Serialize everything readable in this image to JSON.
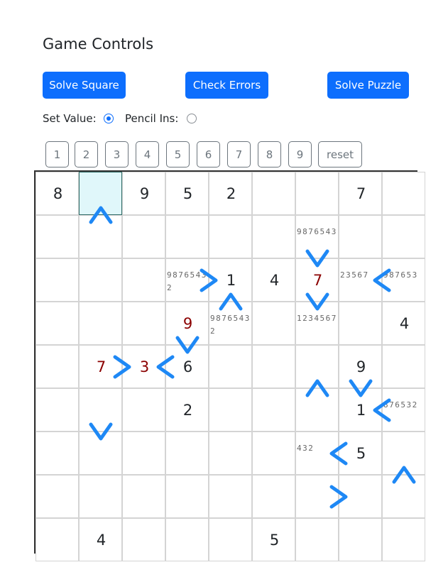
{
  "title": "Game Controls",
  "buttons": {
    "solve_square": "Solve Square",
    "check_errors": "Check Errors",
    "solve_puzzle": "Solve Puzzle"
  },
  "mode": {
    "set_value_label": "Set Value:",
    "pencil_label": "Pencil Ins:",
    "selected": "set_value"
  },
  "number_pad": [
    "1",
    "2",
    "3",
    "4",
    "5",
    "6",
    "7",
    "8",
    "9",
    "reset"
  ],
  "colors": {
    "primary": "#0d6efd",
    "error": "#8b0000",
    "selected_cell": "#e0f7fa",
    "arrow": "#1e88f5"
  },
  "grid": {
    "selected": [
      0,
      1
    ],
    "values": [
      [
        "8",
        "",
        "9",
        "5",
        "2",
        "",
        "",
        "7",
        ""
      ],
      [
        "",
        "",
        "",
        "",
        "",
        "",
        "",
        "",
        ""
      ],
      [
        "",
        "",
        "",
        "",
        "1",
        "4",
        "7",
        "",
        ""
      ],
      [
        "",
        "",
        "",
        "9",
        "",
        "",
        "",
        "",
        "4"
      ],
      [
        "",
        "7",
        "3",
        "6",
        "",
        "",
        "",
        "9",
        ""
      ],
      [
        "",
        "",
        "",
        "2",
        "",
        "",
        "",
        "1",
        ""
      ],
      [
        "",
        "",
        "",
        "",
        "",
        "",
        "",
        "5",
        ""
      ],
      [
        "",
        "",
        "",
        "",
        "",
        "",
        "",
        "",
        ""
      ],
      [
        "",
        "4",
        "",
        "",
        "",
        "5",
        "",
        "",
        ""
      ]
    ],
    "errors": [
      [
        2,
        6
      ],
      [
        3,
        3
      ],
      [
        4,
        1
      ],
      [
        4,
        2
      ]
    ],
    "pencil": [
      {
        "row": 1,
        "col": 6,
        "text": "9876543"
      },
      {
        "row": 2,
        "col": 3,
        "text": "98765432"
      },
      {
        "row": 2,
        "col": 7,
        "text": "23567"
      },
      {
        "row": 2,
        "col": 8,
        "text": "987653"
      },
      {
        "row": 3,
        "col": 4,
        "text": "98765432"
      },
      {
        "row": 3,
        "col": 6,
        "text": "1234567"
      },
      {
        "row": 5,
        "col": 8,
        "text": "876532"
      },
      {
        "row": 6,
        "col": 6,
        "text": "432"
      }
    ]
  },
  "inequalities": [
    {
      "type": "v",
      "row": 0,
      "col": 1,
      "dir": "up"
    },
    {
      "type": "v",
      "row": 1,
      "col": 6,
      "dir": "down"
    },
    {
      "type": "h",
      "row": 2,
      "col": 3,
      "dir": "right"
    },
    {
      "type": "h",
      "row": 2,
      "col": 7,
      "dir": "left"
    },
    {
      "type": "v",
      "row": 2,
      "col": 4,
      "dir": "up"
    },
    {
      "type": "v",
      "row": 2,
      "col": 6,
      "dir": "down"
    },
    {
      "type": "v",
      "row": 3,
      "col": 3,
      "dir": "down"
    },
    {
      "type": "h",
      "row": 4,
      "col": 1,
      "dir": "right"
    },
    {
      "type": "h",
      "row": 4,
      "col": 2,
      "dir": "left"
    },
    {
      "type": "v",
      "row": 4,
      "col": 6,
      "dir": "up"
    },
    {
      "type": "v",
      "row": 4,
      "col": 7,
      "dir": "down"
    },
    {
      "type": "v",
      "row": 5,
      "col": 1,
      "dir": "down"
    },
    {
      "type": "h",
      "row": 5,
      "col": 7,
      "dir": "left"
    },
    {
      "type": "h",
      "row": 6,
      "col": 6,
      "dir": "left"
    },
    {
      "type": "v",
      "row": 6,
      "col": 8,
      "dir": "up"
    },
    {
      "type": "h",
      "row": 7,
      "col": 6,
      "dir": "right"
    }
  ]
}
